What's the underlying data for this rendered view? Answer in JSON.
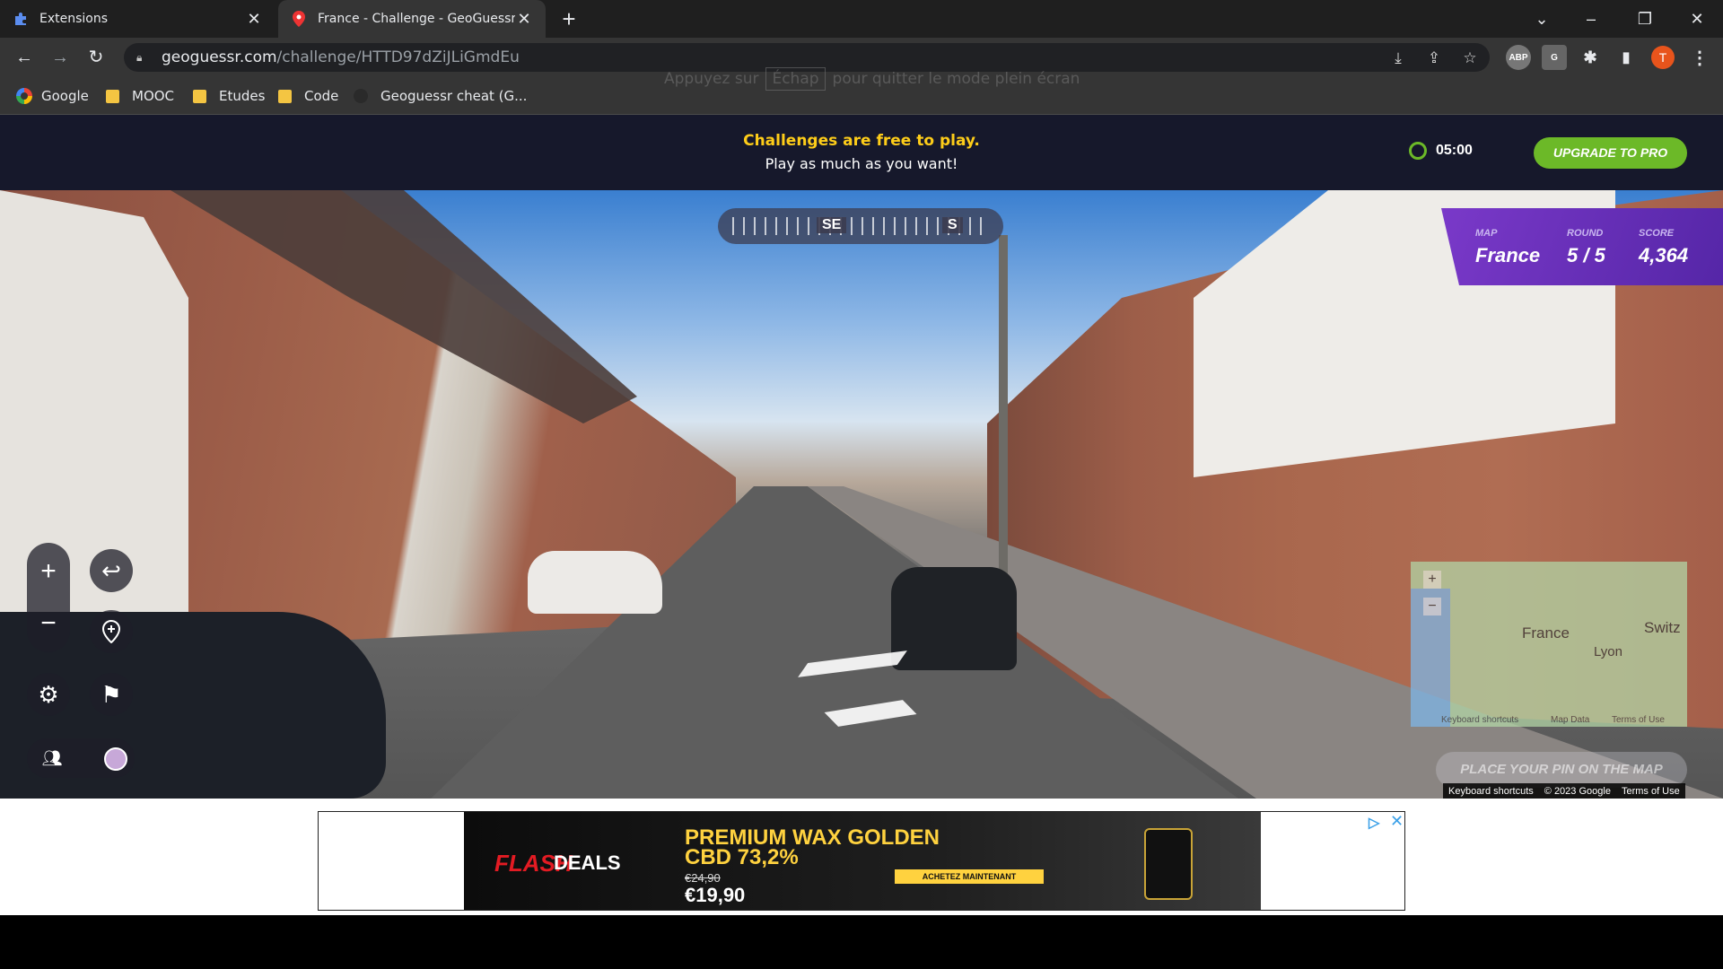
{
  "browser": {
    "tabs": [
      {
        "title": "Extensions",
        "icon": "puzzle-icon",
        "active": false
      },
      {
        "title": "France - Challenge - GeoGuessr",
        "icon": "pin-icon",
        "active": true
      }
    ],
    "new_tab_symbol": "+",
    "url_host": "geoguessr.com",
    "url_path": "/challenge/HTTD97dZiJLiGmdEu",
    "fullscreen_hint_pre": "Appuyez sur",
    "fullscreen_hint_key": "Échap",
    "fullscreen_hint_post": "pour quitter le mode plein écran",
    "profile_initial": "T",
    "extensions": [
      "ABP",
      "G"
    ],
    "bookmarks": [
      {
        "label": "Google",
        "icon": "google-icon"
      },
      {
        "label": "MOOC",
        "icon": "folder-icon"
      },
      {
        "label": "Etudes",
        "icon": "folder-icon"
      },
      {
        "label": "Code",
        "icon": "folder-icon"
      },
      {
        "label": "Geoguessr cheat (G...",
        "icon": "globe-icon"
      }
    ]
  },
  "header": {
    "promo_line1": "Challenges are free to play.",
    "promo_line2": "Play as much as you want!",
    "timer": "05:00",
    "upgrade_label": "UPGRADE TO PRO"
  },
  "compass": {
    "primary": "SE",
    "secondary": "S"
  },
  "status": {
    "map_label": "MAP",
    "map_value": "France",
    "round_label": "ROUND",
    "round_value": "5 / 5",
    "score_label": "SCORE",
    "score_value": "4,364"
  },
  "minimap": {
    "labels": [
      "France",
      "Lyon",
      "Switz"
    ],
    "footer": [
      "Keyboard shortcuts",
      "Map Data",
      "Terms of Use"
    ],
    "place_pin": "PLACE YOUR PIN ON THE MAP"
  },
  "streetview_footer": [
    "Keyboard shortcuts",
    "© 2023 Google",
    "Terms of Use"
  ],
  "ad": {
    "flash": "FLASH",
    "deals": "DEALS",
    "headline_line1": "PREMIUM WAX GOLDEN",
    "headline_line2": "CBD 73,2%",
    "old_price": "€24,90",
    "new_price": "€19,90",
    "cta": "ACHETEZ MAINTENANT"
  },
  "colors": {
    "accent_green": "#6cb928",
    "promo_yellow": "#fecd19",
    "status_purple": "#6a32bb"
  }
}
